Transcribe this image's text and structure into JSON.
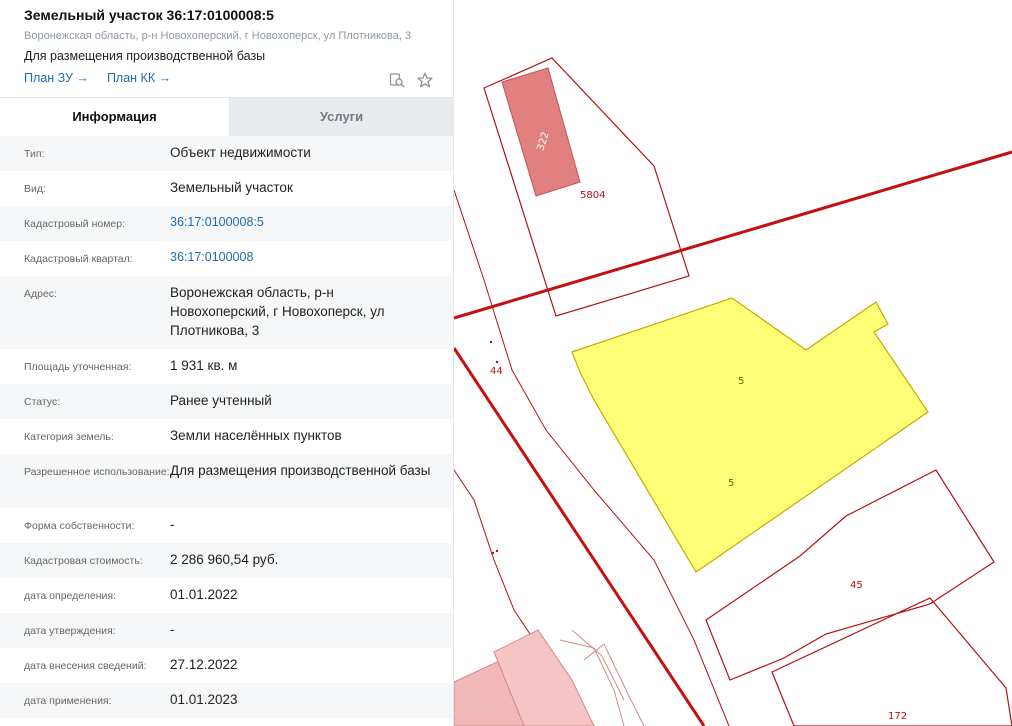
{
  "header": {
    "title": "Земельный участок 36:17:0100008:5",
    "address": "Воронежская область, р-н Новохоперский, г Новохоперск, ул Плотникова, 3",
    "purpose": "Для размещения производственной базы",
    "link_plan_zu": "План ЗУ →",
    "link_plan_kk": "План КК →"
  },
  "tabs": {
    "info": "Информация",
    "services": "Услуги"
  },
  "rows": [
    {
      "label": "Тип:",
      "value": "Объект недвижимости"
    },
    {
      "label": "Вид:",
      "value": "Земельный участок"
    },
    {
      "label": "Кадастровый номер:",
      "value": "36:17:0100008:5"
    },
    {
      "label": "Кадастровый квартал:",
      "value": "36:17:0100008"
    },
    {
      "label": "Адрес:",
      "value": "Воронежская область, р-н Новохоперский, г Новохоперск, ул Плотникова, 3"
    },
    {
      "label": "Площадь уточненная:",
      "value": "1 931 кв. м"
    },
    {
      "label": "Статус:",
      "value": "Ранее учтенный"
    },
    {
      "label": "Категория земель:",
      "value": "Земли населённых пунктов"
    },
    {
      "label": "Разрешенное использование:",
      "value": "Для размещения производственной базы"
    },
    {
      "label": "Форма собственности:",
      "value": "-"
    },
    {
      "label": "Кадастровая стоимость:",
      "value": "2 286 960,54 руб."
    },
    {
      "label": "дата определения:",
      "value": "01.01.2022"
    },
    {
      "label": "дата утверждения:",
      "value": "-"
    },
    {
      "label": "дата внесения сведений:",
      "value": "27.12.2022"
    },
    {
      "label": "дата применения:",
      "value": "01.01.2023"
    }
  ],
  "map": {
    "labels": {
      "building_322": "322",
      "parcel_5804": "5804",
      "parcel_44": "44",
      "parcel_5a": "5",
      "parcel_5b": "5",
      "parcel_45": "45",
      "parcel_172": "172"
    },
    "colors": {
      "boundary": "#b21212",
      "selected_fill": "#ffff77",
      "selected_stroke": "#c8a800",
      "building_fill": "#e08080"
    }
  },
  "icons": {
    "search_map": "search-map-icon",
    "favorite": "star-icon"
  }
}
